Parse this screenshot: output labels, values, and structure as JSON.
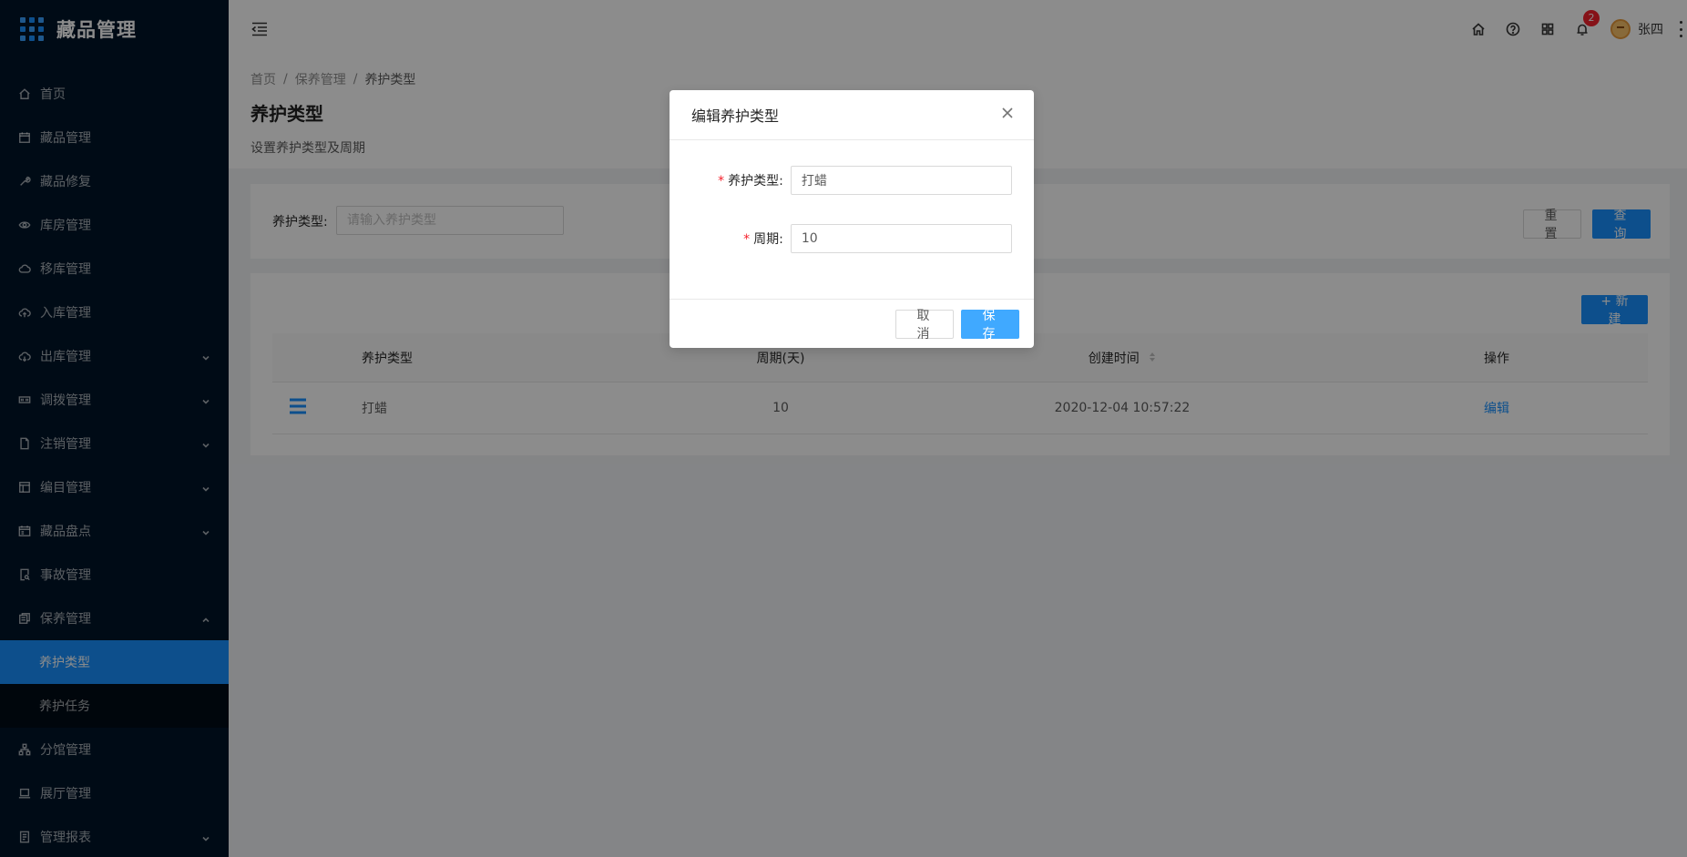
{
  "app": {
    "title": "藏品管理"
  },
  "sidebar": {
    "items": [
      {
        "label": "首页",
        "icon": "home-icon"
      },
      {
        "label": "藏品管理",
        "icon": "calendar-icon"
      },
      {
        "label": "藏品修复",
        "icon": "wrench-icon"
      },
      {
        "label": "库房管理",
        "icon": "eye-icon"
      },
      {
        "label": "移库管理",
        "icon": "cloud-icon"
      },
      {
        "label": "入库管理",
        "icon": "cloud-upload-icon"
      },
      {
        "label": "出库管理",
        "icon": "cloud-download-icon"
      },
      {
        "label": "调拨管理",
        "icon": "swap-icon"
      },
      {
        "label": "注销管理",
        "icon": "file-icon"
      },
      {
        "label": "编目管理",
        "icon": "layout-icon"
      },
      {
        "label": "藏品盘点",
        "icon": "schedule-icon"
      },
      {
        "label": "事故管理",
        "icon": "file-search-icon"
      },
      {
        "label": "保养管理",
        "icon": "reconciliation-icon"
      },
      {
        "label": "分馆管理",
        "icon": "cluster-icon"
      },
      {
        "label": "展厅管理",
        "icon": "laptop-icon"
      },
      {
        "label": "管理报表",
        "icon": "report-icon"
      }
    ],
    "submenu": [
      {
        "label": "养护类型"
      },
      {
        "label": "养护任务"
      }
    ]
  },
  "header": {
    "notification_count": "2",
    "user_name": "张四"
  },
  "breadcrumb": {
    "home": "首页",
    "parent": "保养管理",
    "current": "养护类型",
    "sep": "/"
  },
  "page": {
    "title": "养护类型",
    "description": "设置养护类型及周期"
  },
  "search": {
    "label": "养护类型:",
    "placeholder": "请输入养护类型",
    "reset_label": "重置",
    "query_label": "查询"
  },
  "table": {
    "new_label": "+ 新建",
    "columns": [
      "养护类型",
      "周期(天)",
      "创建时间",
      "操作"
    ],
    "rows": [
      {
        "type": "打蜡",
        "cycle": "10",
        "created": "2020-12-04 10:57:22",
        "action": "编辑"
      }
    ]
  },
  "modal": {
    "title": "编辑养护类型",
    "type_label": "养护类型:",
    "type_value": "打蜡",
    "cycle_label": "周期:",
    "cycle_value": "10",
    "required_mark": "*",
    "cancel_label": "取消",
    "save_label": "保存"
  },
  "colors": {
    "sidebar_bg": "#001529",
    "primary": "#1890ff",
    "danger": "#f5222d"
  }
}
